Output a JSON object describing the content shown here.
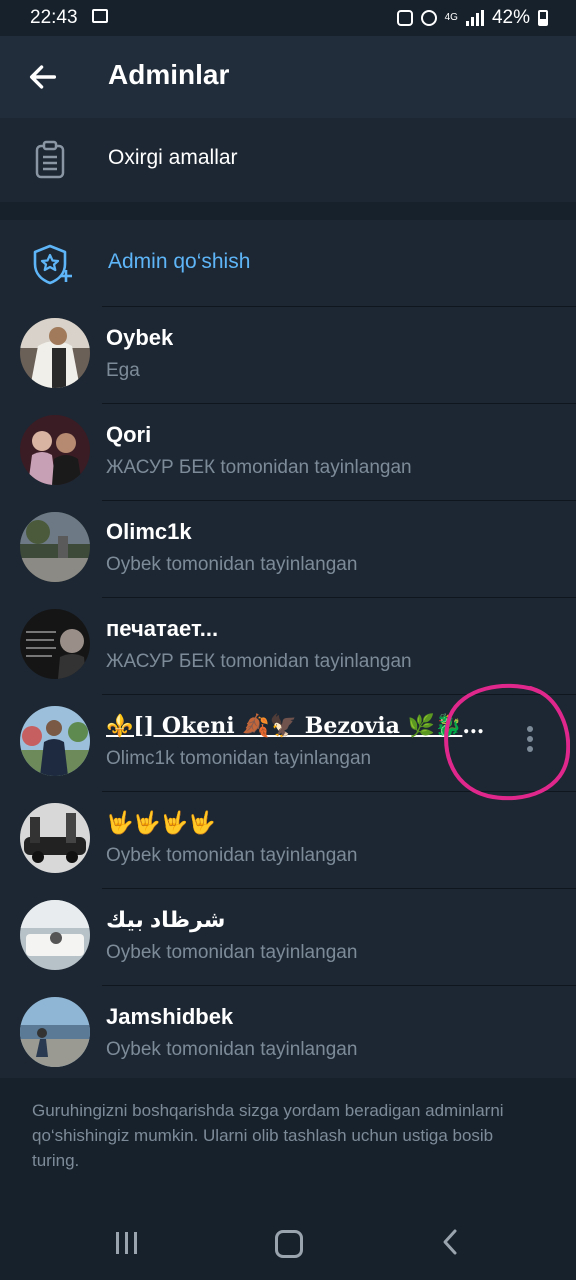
{
  "status_bar": {
    "time": "22:43",
    "network": "4G",
    "battery": "42%",
    "icons": [
      "gallery-icon",
      "lock-icon",
      "alarm-icon",
      "signal-icon",
      "battery-icon"
    ]
  },
  "header": {
    "title": "Adminlar",
    "back_icon": "arrow-left-icon"
  },
  "recent_actions": {
    "label": "Oxirgi amallar",
    "icon": "clipboard-icon"
  },
  "add_admin": {
    "label": "Admin qo‘shish",
    "icon": "shield-star-plus-icon",
    "color": "#5eb5f7"
  },
  "admins": [
    {
      "name": "Oybek",
      "subtitle": "Ega"
    },
    {
      "name": "Qori",
      "subtitle": "ЖАСУР БЕК tomonidan tayinlangan"
    },
    {
      "name": "Olimc1k",
      "subtitle": "Oybek tomonidan tayinlangan"
    },
    {
      "name": "печатает...",
      "subtitle": "ЖАСУР БЕК tomonidan tayinlangan"
    },
    {
      "name": "⚜️[] 𝐎𝐤𝐞𝐧𝐢 🍂🦅 𝐁𝐞𝐳𝐨𝐯𝐢𝐚 🌿🐉 𝐐𝐥...",
      "subtitle": "Olimc1k tomonidan tayinlangan",
      "menu_icon": "more-vertical-icon"
    },
    {
      "name": "🤟🤟🤟🤟",
      "subtitle": "Oybek tomonidan tayinlangan"
    },
    {
      "name": "شرظاد بيك",
      "subtitle": "Oybek tomonidan tayinlangan"
    },
    {
      "name": "Jamshidbek",
      "subtitle": "Oybek tomonidan tayinlangan"
    }
  ],
  "footer": {
    "text": "Guruhingizni boshqarishda sizga yordam beradigan adminlarni qo‘shishingiz mumkin. Ularni olib tashlash uchun ustiga bosib turing."
  },
  "colors": {
    "background": "#1d2733",
    "header": "#212d3b",
    "accent": "#5eb5f7",
    "secondary_text": "#7d8b99",
    "annotation": "#e0288c"
  }
}
